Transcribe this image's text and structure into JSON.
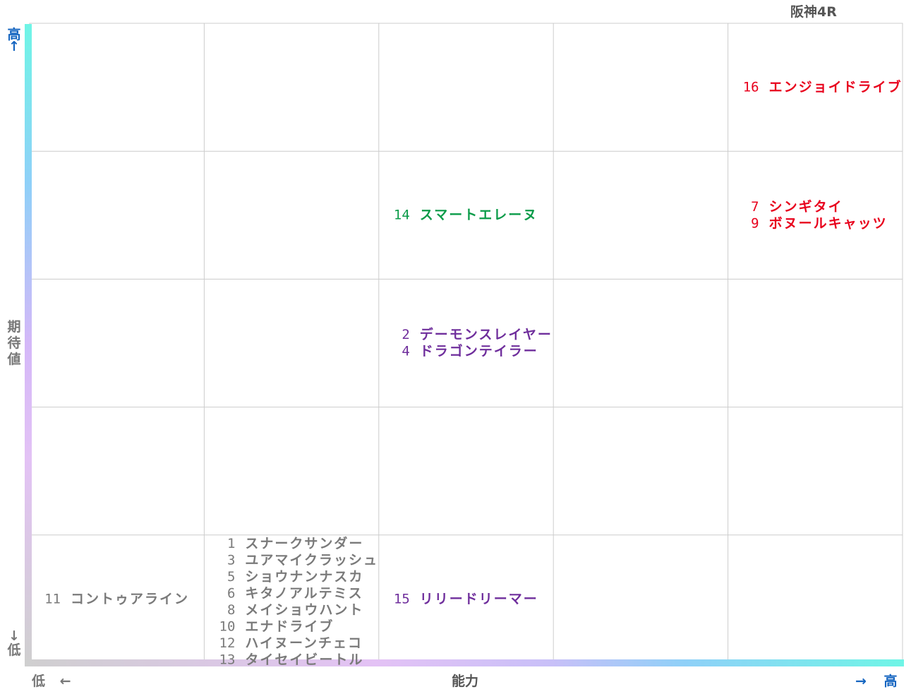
{
  "race_title": "阪神4R",
  "y_axis": {
    "high": "高",
    "high_arrow": "↑",
    "label": "期待値",
    "low_arrow": "↓",
    "low": "低"
  },
  "x_axis": {
    "low": "低",
    "low_arrow": "←",
    "label": "能力",
    "high_arrow": "→",
    "high": "高"
  },
  "colors": {
    "red": "#e8001c",
    "green": "#0a9b48",
    "purple": "#6f2e9c",
    "gray": "#7a7a7a",
    "blue": "#1565c0"
  },
  "chart_data": {
    "type": "table",
    "columns": 5,
    "rows": 5,
    "cells": [
      {
        "col": 4,
        "row": 0,
        "color": "red",
        "entries": [
          {
            "num": "16",
            "name": "エンジョイドライブ"
          }
        ]
      },
      {
        "col": 2,
        "row": 1,
        "color": "green",
        "entries": [
          {
            "num": "14",
            "name": "スマートエレーヌ"
          }
        ]
      },
      {
        "col": 4,
        "row": 1,
        "color": "red",
        "entries": [
          {
            "num": "7",
            "name": "シンギタイ"
          },
          {
            "num": "9",
            "name": "ボヌールキャッツ"
          }
        ]
      },
      {
        "col": 2,
        "row": 2,
        "color": "purple",
        "entries": [
          {
            "num": "2",
            "name": "デーモンスレイヤー"
          },
          {
            "num": "4",
            "name": "ドラゴンテイラー"
          }
        ]
      },
      {
        "col": 0,
        "row": 4,
        "color": "gray",
        "entries": [
          {
            "num": "11",
            "name": "コントゥアライン"
          }
        ]
      },
      {
        "col": 1,
        "row": 4,
        "color": "gray",
        "entries": [
          {
            "num": "1",
            "name": "スナークサンダー"
          },
          {
            "num": "3",
            "name": "ユアマイクラッシュ"
          },
          {
            "num": "5",
            "name": "ショウナンナスカ"
          },
          {
            "num": "6",
            "name": "キタノアルテミス"
          },
          {
            "num": "8",
            "name": "メイショウハント"
          },
          {
            "num": "10",
            "name": "エナドライブ"
          },
          {
            "num": "12",
            "name": "ハイヌーンチェコ"
          },
          {
            "num": "13",
            "name": "タイセイビートル"
          }
        ]
      },
      {
        "col": 2,
        "row": 4,
        "color": "purple",
        "entries": [
          {
            "num": "15",
            "name": "リリードリーマー"
          }
        ]
      }
    ]
  }
}
